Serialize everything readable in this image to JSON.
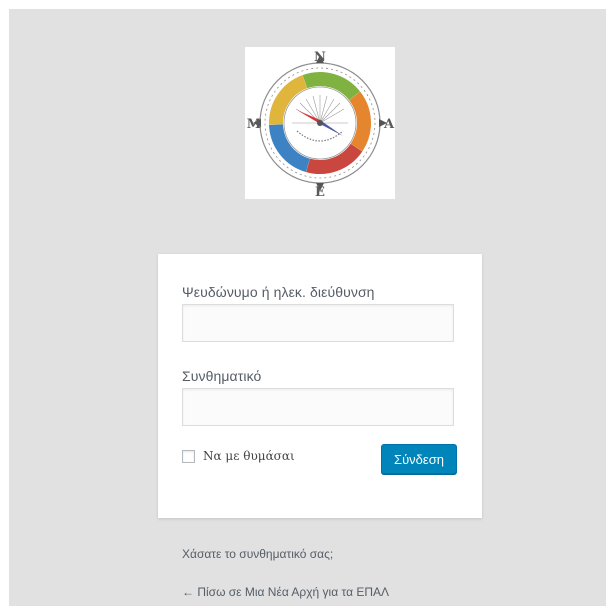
{
  "logo": {
    "alt_letters": {
      "north": "N",
      "east": "A",
      "south": "E",
      "west": "M"
    },
    "colors": {
      "ring_green": "#7fb241",
      "ring_orange": "#e5852e",
      "ring_red": "#c9473f",
      "ring_blue": "#3d82c2",
      "ring_yellow": "#e0b53b",
      "needle_red": "#d2373b",
      "needle_blue": "#4b59a8"
    }
  },
  "login_form": {
    "username_label": "Ψευδώνυμο ή ηλεκ. διεύθυνση",
    "username_value": "",
    "password_label": "Συνθηματικό",
    "password_value": "",
    "remember_label": "Να με θυμάσαι",
    "remember_checked": false,
    "submit_label": "Σύνδεση"
  },
  "links": {
    "lost_password": "Χάσατε το συνθηματικό σας;",
    "back_to_site": "← Πίσω σε Μια Νέα Αρχή για τα ΕΠΑΛ"
  },
  "colors": {
    "page_background": "#e1e1e1",
    "primary_button": "#0085ba",
    "text": "#555d66"
  }
}
